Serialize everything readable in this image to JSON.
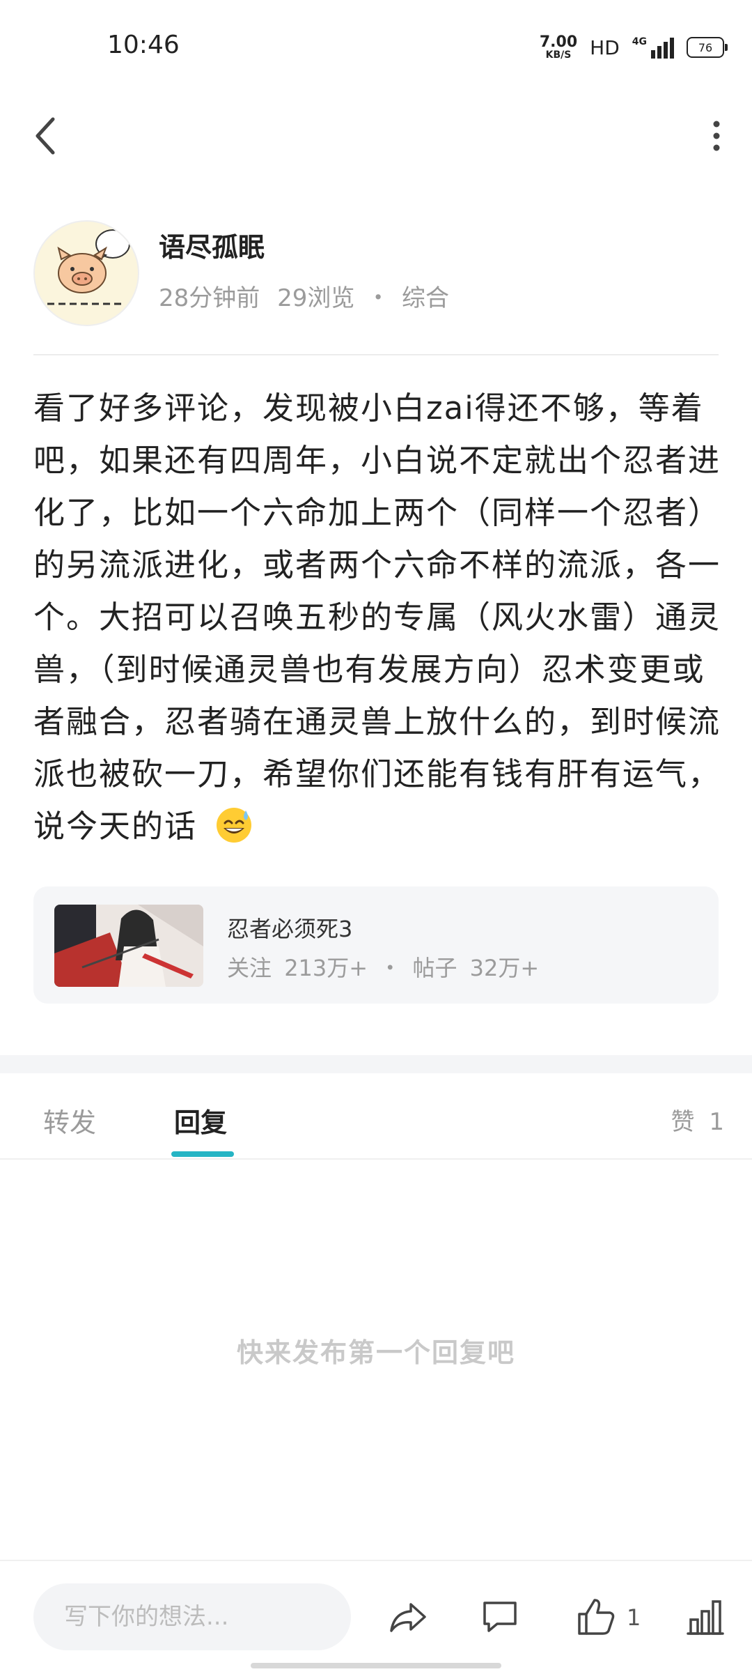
{
  "status_bar": {
    "time": "10:46",
    "net_speed_value": "7.00",
    "net_speed_unit": "KB/S",
    "hd": "HD",
    "signal_label": "4G",
    "battery": "76"
  },
  "author": {
    "name": "语尽孤眠",
    "time_ago": "28分钟前",
    "views": "29浏览",
    "category": "综合",
    "separator": "・",
    "avatar_icon": "pig-avatar-icon"
  },
  "post": {
    "content": "看了好多评论，发现被小白zai得还不够，等着吧，如果还有四周年，小白说不定就出个忍者进化了，比如一个六命加上两个（同样一个忍者）的另流派进化，或者两个六命不样的流派，各一个。大招可以召唤五秒的专属（风火水雷）通灵兽，（到时候通灵兽也有发展方向）忍术变更或者融合，忍者骑在通灵兽上放什么的，到时候流派也被砍一刀，希望你们还能有钱有肝有运气，说今天的话",
    "emoji": "grinning-sweat-emoji"
  },
  "forum": {
    "name": "忍者必须死3",
    "follow_label": "关注",
    "follow_count": "213万+",
    "dot": "・",
    "posts_label": "帖子",
    "posts_count": "32万+"
  },
  "tabs": {
    "repost": "转发",
    "reply": "回复",
    "likes_label": "赞",
    "likes_count": "1"
  },
  "empty_state": "快来发布第一个回复吧",
  "bottom_bar": {
    "input_placeholder": "写下你的想法...",
    "like_count": "1"
  },
  "colors": {
    "accent": "#25b4c4",
    "muted_text": "#9b9b9b",
    "card_bg": "#f5f6f8"
  }
}
